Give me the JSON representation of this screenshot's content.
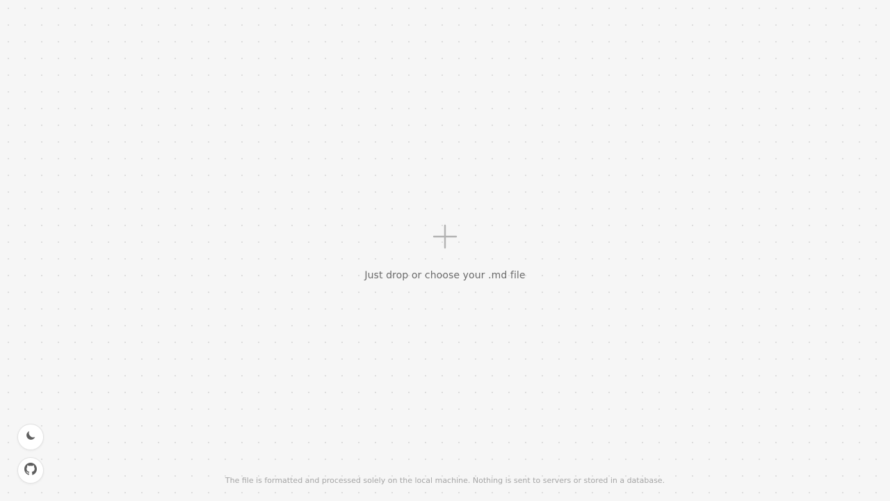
{
  "upload": {
    "icon": "plus-icon",
    "label": "Just drop or choose your .md file",
    "accepted_extension": ".md"
  },
  "controls": {
    "theme_toggle_icon": "moon-icon",
    "github_link_icon": "github-icon"
  },
  "footer": {
    "privacy_note": "The file is formatted and processed solely on the local machine. Nothing is sent to servers or stored in a database."
  },
  "colors": {
    "background": "#f6f6f6",
    "dot_grid": "#d9d9d9",
    "icon_gray": "#b3b3b3",
    "label_text": "#6b6b6b",
    "footer_text": "#a5a5a5"
  }
}
